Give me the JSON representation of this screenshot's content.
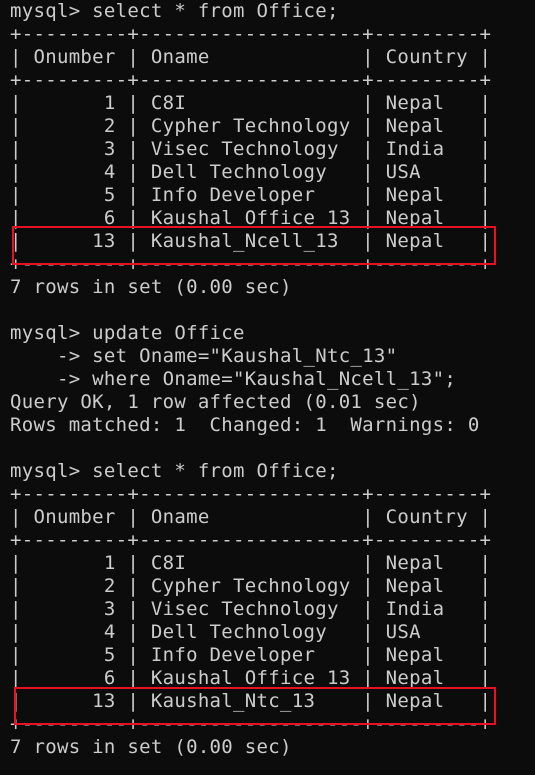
{
  "terminal": {
    "lines": [
      "mysql> select * from Office;",
      "+---------+-------------------+---------+",
      "| Onumber | Oname             | Country |",
      "+---------+-------------------+---------+",
      "|       1 | C8I               | Nepal   |",
      "|       2 | Cypher Technology | Nepal   |",
      "|       3 | Visec Technology  | India   |",
      "|       4 | Dell Technology   | USA     |",
      "|       5 | Info Developer    | Nepal   |",
      "|       6 | Kaushal Office 13 | Nepal   |",
      "|      13 | Kaushal_Ncell_13  | Nepal   |",
      "+---------+-------------------+---------+",
      "7 rows in set (0.00 sec)",
      "",
      "mysql> update Office",
      "    -> set Oname=\"Kaushal_Ntc_13\"",
      "    -> where Oname=\"Kaushal_Ncell_13\";",
      "Query OK, 1 row affected (0.01 sec)",
      "Rows matched: 1  Changed: 1  Warnings: 0",
      "",
      "mysql> select * from Office;",
      "+---------+-------------------+---------+",
      "| Onumber | Oname             | Country |",
      "+---------+-------------------+---------+",
      "|       1 | C8I               | Nepal   |",
      "|       2 | Cypher Technology | Nepal   |",
      "|       3 | Visec Technology  | India   |",
      "|       4 | Dell Technology   | USA     |",
      "|       5 | Info Developer    | Nepal   |",
      "|       6 | Kaushal_Office_13 | Nepal   |",
      "|      13 | Kaushal_Ntc_13    | Nepal   |",
      "+---------+-------------------+---------+",
      "7 rows in set (0.00 sec)"
    ]
  },
  "highlight_color": "#e81123"
}
